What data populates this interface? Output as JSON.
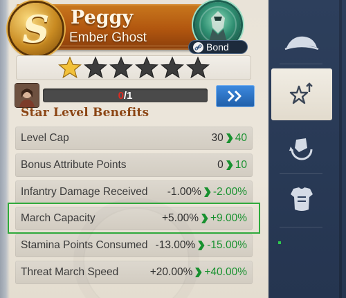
{
  "hero": {
    "rank_letter": "S",
    "name": "Peggy",
    "title": "Ember Ghost",
    "bond_label": "Bond"
  },
  "stars": {
    "filled": 1,
    "total": 6,
    "filled_color": "#f2c13a",
    "empty_color": "#3c3c3c"
  },
  "progress": {
    "current": "0",
    "separator_total": "/1",
    "fraction": 0
  },
  "section": {
    "heading": "Star Level Benefits"
  },
  "stats": [
    {
      "label": "Level Cap",
      "current": "30",
      "next": "40"
    },
    {
      "label": "Bonus Attribute Points",
      "current": "0",
      "next": "10"
    },
    {
      "label": "Infantry Damage Received",
      "current": "-1.00%",
      "next": "-2.00%"
    },
    {
      "label": "March Capacity",
      "current": "+5.00%",
      "next": "+9.00%"
    },
    {
      "label": "Stamina Points Consumed",
      "current": "-13.00%",
      "next": "-15.00%"
    },
    {
      "label": "Threat March Speed",
      "current": "+20.00%",
      "next": "+40.00%"
    }
  ],
  "highlighted_stat": "March Capacity",
  "sidebar": {
    "items": [
      {
        "icon": "hat-icon"
      },
      {
        "icon": "star-upgrade-icon",
        "active": true
      },
      {
        "icon": "fist-icon"
      },
      {
        "icon": "armor-icon"
      }
    ]
  },
  "colors": {
    "banner": "#b1560f",
    "accent_green": "#18912f",
    "highlight_border": "#2faa3c",
    "upgrade_button": "#2f74c6",
    "sidebar_bg": "#2d3f5c"
  }
}
